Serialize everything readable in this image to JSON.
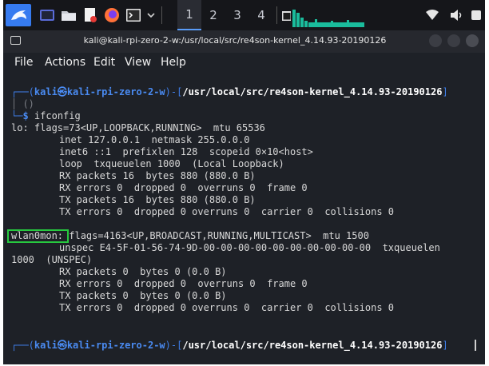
{
  "panel": {
    "workspaces": [
      "1",
      "2",
      "3",
      "4"
    ],
    "active_workspace": "1"
  },
  "window": {
    "title": "kali@kali-rpi-zero-2-w:/usr/local/src/re4son-kernel_4.14.93-20190126"
  },
  "menu": {
    "file": "File",
    "actions": "Actions",
    "edit": "Edit",
    "view": "View",
    "help": "Help"
  },
  "terminal": {
    "prompt1": {
      "open": "┌──(",
      "user": "kali",
      "at": "㉿",
      "host": "kali-rpi-zero-2-w",
      "mid": ")-[",
      "path": "/usr/local/src/re4son-kernel_4.14.93-20190126",
      "close": "]",
      "prev_line": "│ ()",
      "cmd_prefix": "└─",
      "dollar": "$",
      "command": "ifconfig"
    },
    "lo": {
      "name": "lo:",
      "flags": " flags=73<UP,LOOPBACK,RUNNING>  mtu 65536",
      "lines": [
        "inet 127.0.0.1  netmask 255.0.0.0",
        "inet6 ::1  prefixlen 128  scopeid 0×10<host>",
        "loop  txqueuelen 1000  (Local Loopback)",
        "RX packets 16  bytes 880 (880.0 B)",
        "RX errors 0  dropped 0  overruns 0  frame 0",
        "TX packets 16  bytes 880 (880.0 B)",
        "TX errors 0  dropped 0 overruns 0  carrier 0  collisions 0"
      ]
    },
    "wlan": {
      "name": "wlan0mon:",
      "flags": " flags=4163<UP,BROADCAST,RUNNING,MULTICAST>  mtu 1500",
      "unspec": "unspec E4-5F-01-56-74-9D-00-00-00-00-00-00-00-00-00-00  txqueuelen",
      "wrap": "1000  (UNSPEC)",
      "lines": [
        "RX packets 0  bytes 0 (0.0 B)",
        "RX errors 0  dropped 0  overruns 0  frame 0",
        "TX packets 0  bytes 0 (0.0 B)",
        "TX errors 0  dropped 0 overruns 0  carrier 0  collisions 0"
      ]
    },
    "prompt2": {
      "open": "┌──(",
      "user": "kali",
      "at": "㉿",
      "host": "kali-rpi-zero-2-w",
      "mid": ")-[",
      "path": "/usr/local/src/re4son-kernel_4.14.93-20190126",
      "close": "]"
    }
  },
  "colors": {
    "prompt_blue": "#3f7ee8",
    "highlight_box": "#27c93f",
    "panel_accent": "#367bf0"
  }
}
